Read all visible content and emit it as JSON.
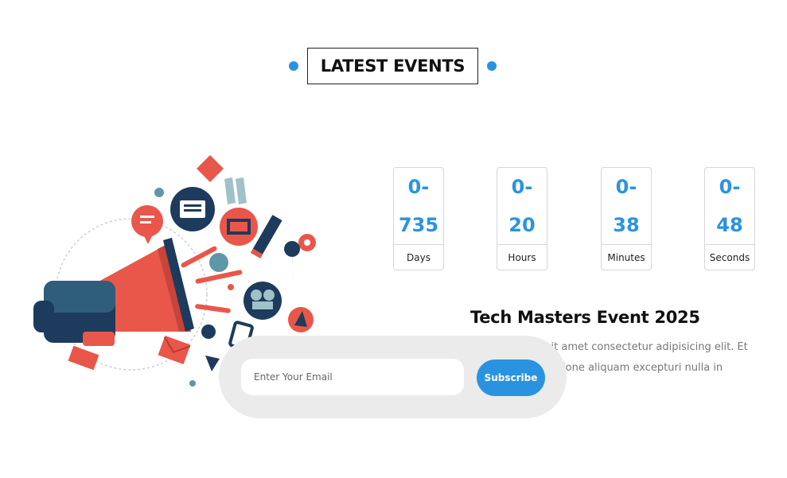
{
  "section": {
    "title": "LATEST EVENTS"
  },
  "countdown": [
    {
      "value": "0-\n735",
      "label": "Days"
    },
    {
      "value": "0-\n20",
      "label": "Hours"
    },
    {
      "value": "0-\n38",
      "label": "Minutes"
    },
    {
      "value": "0-\n48",
      "label": "Seconds"
    }
  ],
  "event": {
    "title": "Tech Masters Event 2025",
    "description": "Lorem ipsum dolor sit amet consectetur adipisicing elit. Et vero tenetur ipsum ratione aliquam excepturi nulla in veritatis porro"
  },
  "subscribe": {
    "email_placeholder": "Enter Your Email",
    "button_label": "Subscribe"
  },
  "colors": {
    "accent": "#2a93e0",
    "illustration_red": "#e8574a",
    "illustration_navy": "#1d3b5c"
  }
}
